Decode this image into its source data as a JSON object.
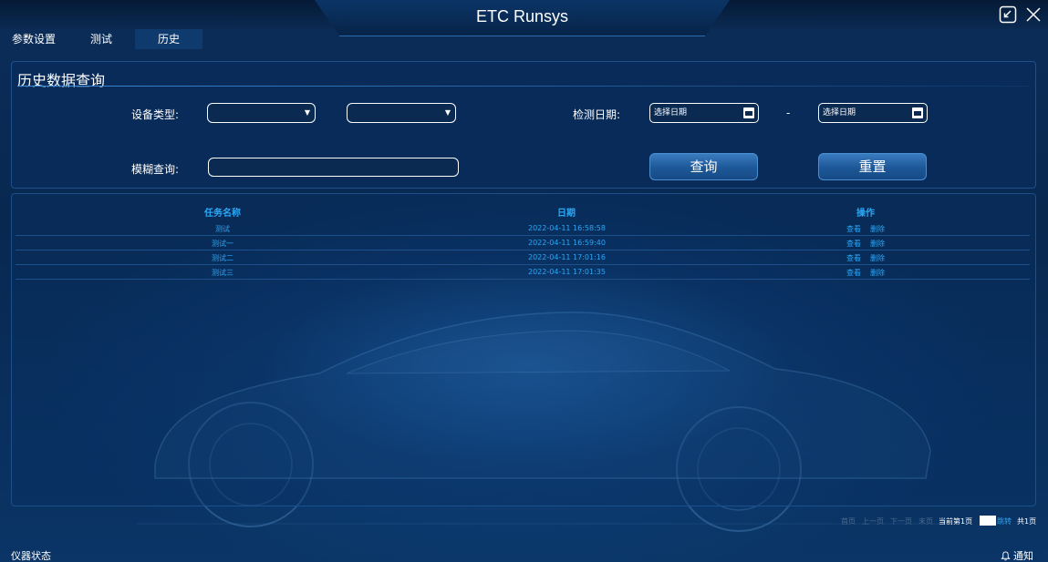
{
  "app": {
    "title": "ETC Runsys"
  },
  "tabs": [
    {
      "label": "参数设置"
    },
    {
      "label": "测试"
    },
    {
      "label": "历史",
      "active": true
    }
  ],
  "query": {
    "title": "历史数据查询",
    "device_type_label": "设备类型:",
    "date_label": "检测日期:",
    "date_start_placeholder": "选择日期",
    "date_end_placeholder": "选择日期",
    "date_separator": "-",
    "fuzzy_label": "模糊查询:",
    "search_button": "查询",
    "reset_button": "重置"
  },
  "table": {
    "columns": [
      "任务名称",
      "日期",
      "操作"
    ],
    "rows": [
      {
        "name": "测试",
        "date": "2022-04-11 16:58:58",
        "view": "查看",
        "delete": "删除"
      },
      {
        "name": "测试一",
        "date": "2022-04-11 16:59:40",
        "view": "查看",
        "delete": "删除"
      },
      {
        "name": "测试二",
        "date": "2022-04-11 17:01:16",
        "view": "查看",
        "delete": "删除"
      },
      {
        "name": "测试三",
        "date": "2022-04-11 17:01:35",
        "view": "查看",
        "delete": "删除"
      }
    ]
  },
  "pagination": {
    "first": "首页",
    "prev": "上一页",
    "next": "下一页",
    "last": "末页",
    "current": "当前第1页",
    "jump": "跳转",
    "total": "共1页"
  },
  "footer": {
    "status": "仪器状态",
    "notify": "通知"
  },
  "colors": {
    "background": "#062449",
    "accent": "#2aa7f5",
    "button": "#1d5797"
  }
}
